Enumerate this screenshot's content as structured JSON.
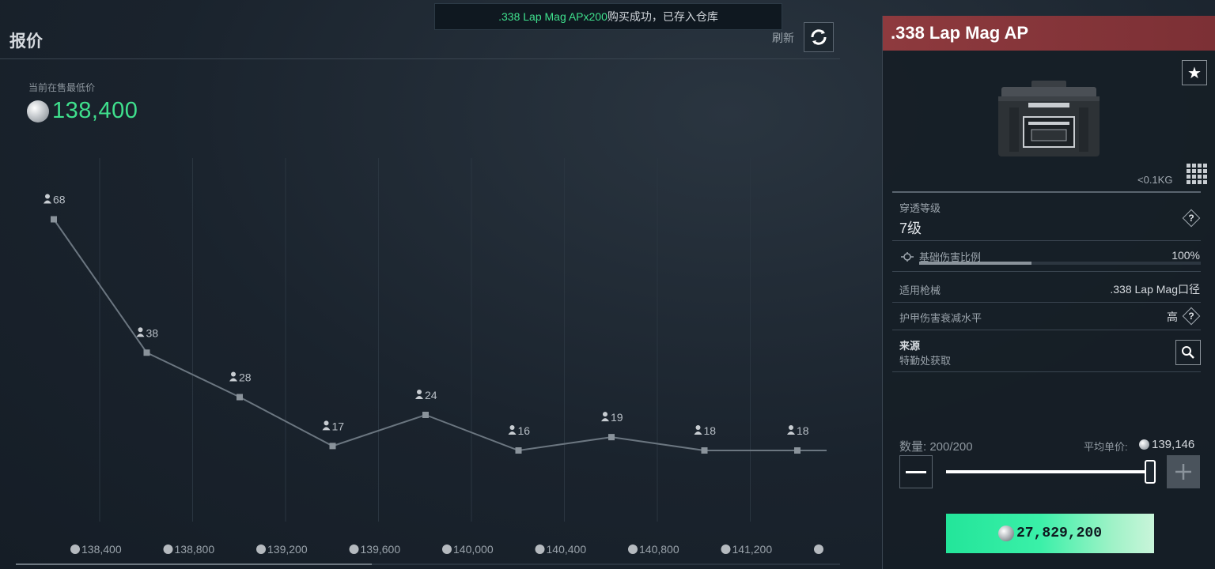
{
  "market": {
    "title": "报价",
    "refresh_label": "刷新",
    "lowest_price_label": "当前在售最低价",
    "lowest_price_value": "138,400"
  },
  "toast": {
    "item_text": ".338 Lap Mag APx200",
    "message": "购买成功，已存入仓库"
  },
  "chart_data": {
    "type": "line",
    "categories": [
      "138,400",
      "138,800",
      "139,200",
      "139,600",
      "140,000",
      "140,400",
      "140,800",
      "141,200",
      ""
    ],
    "series": [
      {
        "values": [
          68,
          38,
          28,
          17,
          24,
          16,
          19,
          16,
          16
        ]
      }
    ],
    "data_labels": [
      "68",
      "38",
      "28",
      "17",
      "24",
      "16",
      "19",
      "18",
      "18"
    ],
    "ylim": [
      0,
      80
    ],
    "grid": true,
    "line_color": "#6b7680",
    "point_color": "#8a939b"
  },
  "item": {
    "name": ".338 Lap Mag AP",
    "weight": "<0.1KG",
    "penetration_label": "穿透等级",
    "penetration_value": "7级",
    "base_damage_label": "基础伤害比例",
    "base_damage_value": "100%",
    "base_damage_fraction": 0.4,
    "compatible_label": "适用枪械",
    "compatible_value": ".338 Lap Mag口径",
    "armor_damage_label": "护甲伤害衰减水平",
    "armor_damage_value": "高",
    "source_label": "来源",
    "source_value": "特勤处获取"
  },
  "purchase": {
    "quantity_label": "数量: 200/200",
    "avg_price_label": "平均单价:",
    "avg_price_value": "139,146",
    "slider_fraction": 1.0,
    "total_value": "27,829,200"
  },
  "colors": {
    "accent_green": "#3fe08d",
    "header_red": "#8e3a3e",
    "buy_button": "#23e59a"
  }
}
